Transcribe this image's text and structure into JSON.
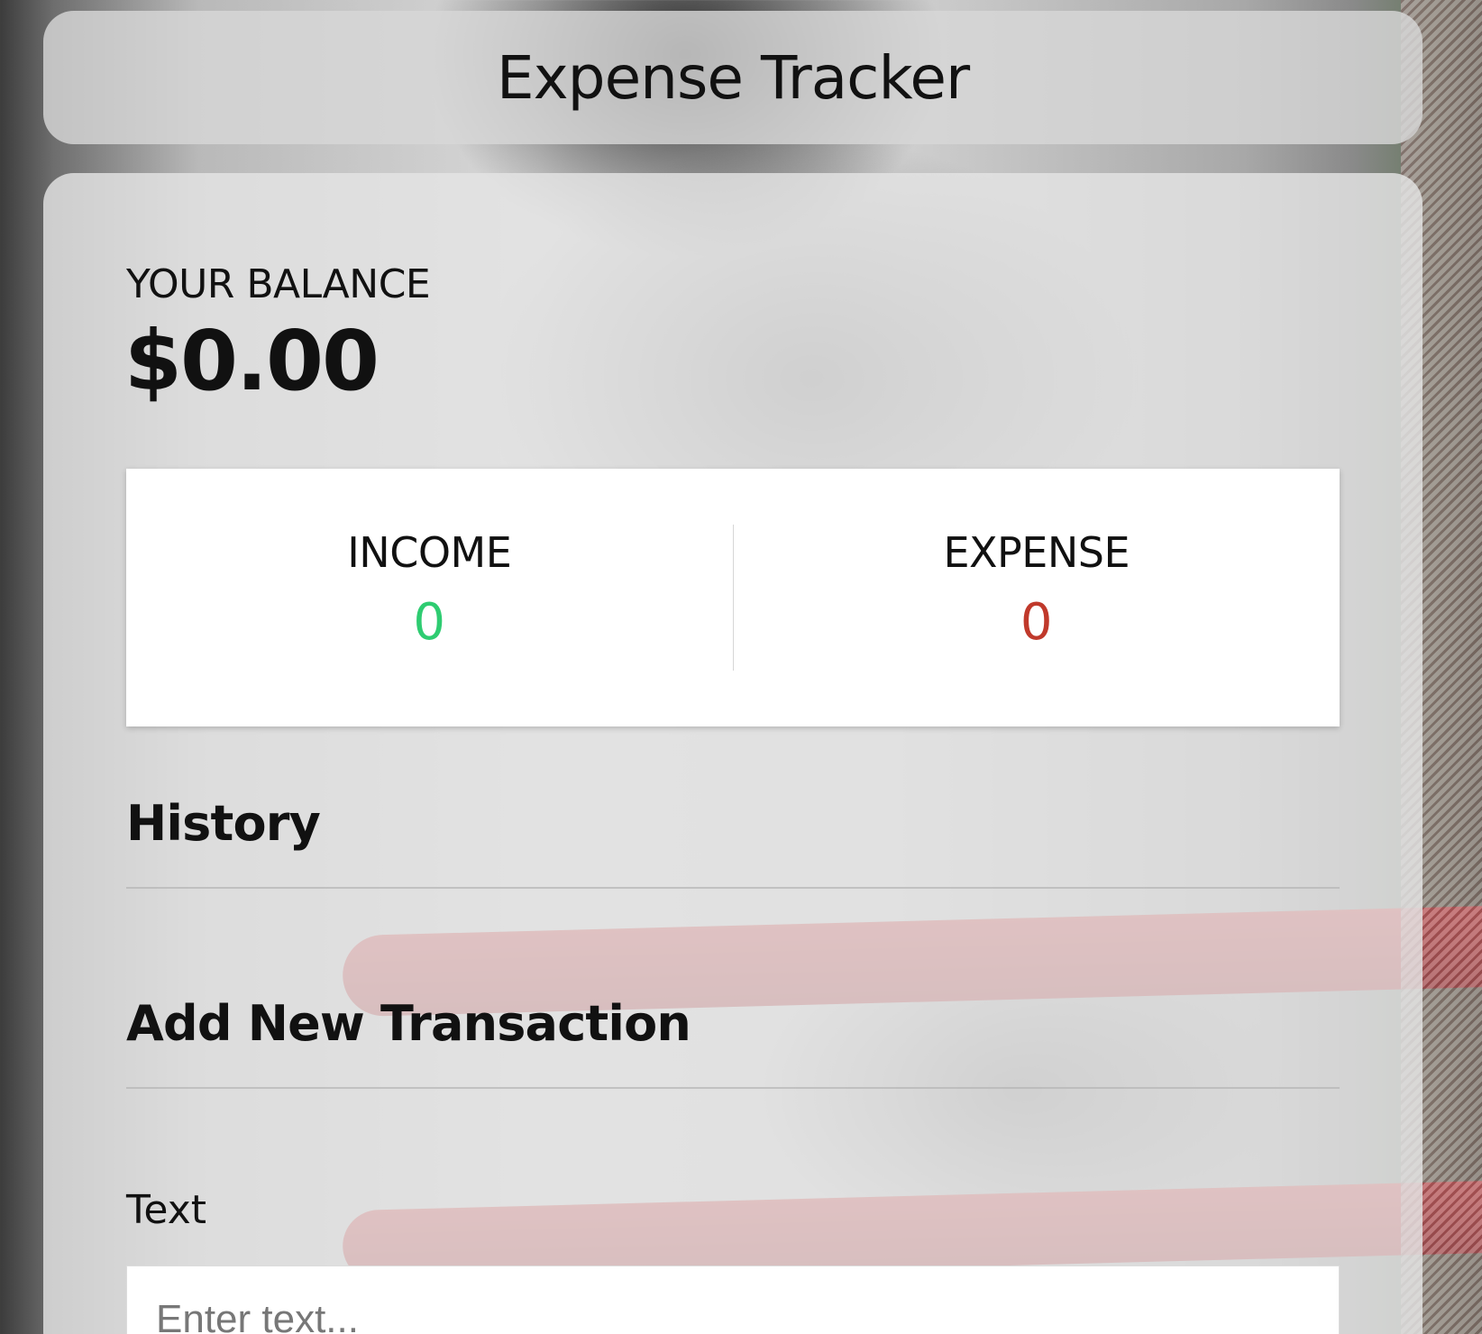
{
  "header": {
    "title": "Expense Tracker"
  },
  "balance": {
    "label": "YOUR BALANCE",
    "value": "$0.00"
  },
  "summary": {
    "income": {
      "label": "INCOME",
      "value": "0",
      "color": "#2ecc71"
    },
    "expense": {
      "label": "EXPENSE",
      "value": "0",
      "color": "#c0392b"
    }
  },
  "history": {
    "title": "History"
  },
  "add_transaction": {
    "title": "Add New Transaction",
    "text_label": "Text",
    "text_placeholder": "Enter text..."
  }
}
